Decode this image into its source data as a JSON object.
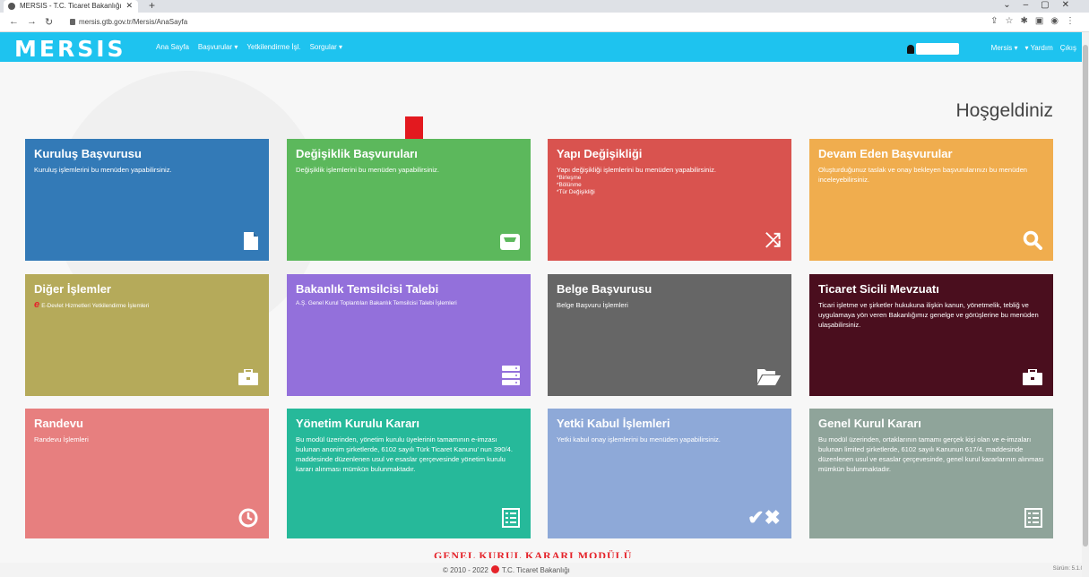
{
  "browser": {
    "tab_title": "MERSIS - T.C. Ticaret Bakanlığı",
    "url": "mersis.gtb.gov.tr/Mersis/AnaSayfa"
  },
  "nav": {
    "logo": "MERSIS",
    "menu": [
      "Ana Sayfa",
      "Başvurular ▾",
      "Yetkilendirme İşl.",
      "Sorgular ▾"
    ],
    "right": [
      "Mersis ▾",
      "▾ Yardım",
      "Çıkış"
    ]
  },
  "welcome": "Hoşgeldiniz",
  "tiles": [
    {
      "title": "Kuruluş Başvurusu",
      "desc": "Kuruluş işlemlerini bu menüden yapabilirsiniz.",
      "color": "#337ab7",
      "icon": "file-icon"
    },
    {
      "title": "Değişiklik Başvuruları",
      "desc": "Değişiklik işlemlerini bu menüden yapabilirsiniz.",
      "color": "#5cb85c",
      "icon": "inbox-icon"
    },
    {
      "title": "Yapı Değişikliği",
      "desc": "Yapı değişikliği işlemlerini bu menüden yapabilirsiniz.",
      "sub": [
        "*Birleşme",
        "*Bölünme",
        "*Tür Değişikliği"
      ],
      "color": "#d9534f",
      "icon": "random-icon"
    },
    {
      "title": "Devam Eden Başvurular",
      "desc": "Oluşturduğunuz taslak ve onay bekleyen başvurularınızı bu menüden inceleyebilirsiniz.",
      "color": "#f0ad4e",
      "icon": "search-icon"
    },
    {
      "title": "Diğer İşlemler",
      "desc": "E-Devlet Hizmetleri Yetkilendirme İşlemleri",
      "color": "#b5aa5a",
      "icon": "briefcase-icon"
    },
    {
      "title": "Bakanlık Temsilcisi Talebi",
      "desc": "A.Ş. Genel Kurul Toplantıları Bakanlık Temsilcisi Talebi İşlemleri",
      "color": "#9370db",
      "icon": "server-icon"
    },
    {
      "title": "Belge Başvurusu",
      "desc": "Belge Başvuru İşlemleri",
      "color": "#666666",
      "icon": "folder-open-icon"
    },
    {
      "title": "Ticaret Sicili Mevzuatı",
      "desc": "Ticari işletme ve şirketler hukukuna ilişkin kanun, yönetmelik, tebliğ ve uygulamaya yön veren Bakanlığımız genelge ve görüşlerine bu menüden ulaşabilirsiniz.",
      "color": "#4a0e1e",
      "icon": "briefcase-icon"
    },
    {
      "title": "Randevu",
      "desc": "Randevu İşlemleri",
      "color": "#e77f7f",
      "icon": "clock-icon"
    },
    {
      "title": "Yönetim Kurulu Kararı",
      "desc": "Bu modül üzerinden, yönetim kurulu üyelerinin tamamının e-imzası bulunan anonim şirketlerde, 6102 sayılı Türk Ticaret Kanunu' nun 390/4. maddesinde düzenlenen usul ve esaslar çerçevesinde yönetim kurulu kararı alınması mümkün bulunmaktadır.",
      "color": "#26b99a",
      "icon": "list-alt-icon"
    },
    {
      "title": "Yetki Kabul İşlemleri",
      "desc": "Yetki kabul onay işlemlerini bu menüden yapabilirsiniz.",
      "color": "#8ea9d8",
      "icon": "check-cross-icon"
    },
    {
      "title": "Genel Kurul Kararı",
      "desc": "Bu modül üzerinden, ortaklarının tamamı gerçek kişi olan ve e-imzaları bulunan limited şirketlerde, 6102 sayılı Kanunun 617/4. maddesinde düzenlenen usul ve esaslar çerçevesinde, genel kurul kararlarının alınması mümkün bulunmaktadır.",
      "color": "#8fa49a",
      "icon": "list-alt-icon"
    }
  ],
  "footer": {
    "banner": "GENEL KURUL KARARI MODÜLÜ",
    "copyright_pre": "© 2010 - 2022",
    "copyright_post": "T.C. Ticaret Bakanlığı",
    "version": "Sürüm: 5.1.0"
  }
}
